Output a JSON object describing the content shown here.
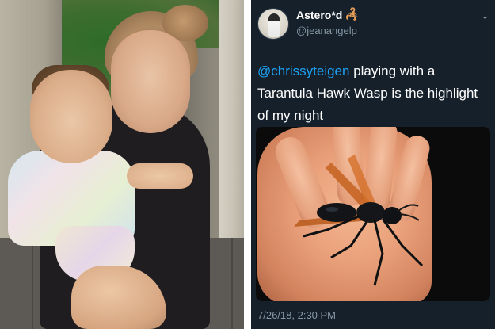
{
  "tweet": {
    "display_name": "Astero*d",
    "name_emoji": "🦂",
    "handle": "@jeanangelp",
    "mention": "@chrissyteigen",
    "text_rest": " playing with a Tarantula Hawk Wasp is the highlight of my night",
    "timestamp": "7/26/18, 2:30 PM",
    "menu_icon": "chevron-down-icon"
  },
  "colors": {
    "tweet_bg": "#15202b",
    "mention": "#1da1f2",
    "secondary_text": "#8899a6"
  }
}
